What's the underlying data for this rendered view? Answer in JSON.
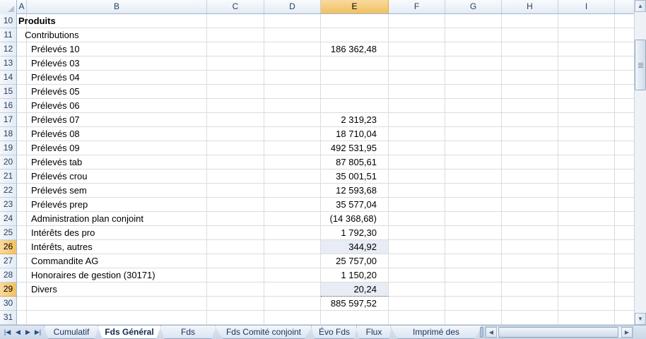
{
  "columns": [
    "A",
    "B",
    "C",
    "D",
    "E",
    "F",
    "G",
    "H",
    "I"
  ],
  "active_column": "E",
  "rows": [
    {
      "num": "10",
      "label": "Produits",
      "value": "",
      "style": "bold",
      "indent": 0
    },
    {
      "num": "11",
      "label": "Contributions",
      "value": "",
      "style": "",
      "indent": 1
    },
    {
      "num": "12",
      "label": "Prélevés 10",
      "value": "186 362,48",
      "style": "",
      "indent": 2
    },
    {
      "num": "13",
      "label": "Prélevés 03",
      "value": "",
      "style": "",
      "indent": 2
    },
    {
      "num": "14",
      "label": "Prélevés 04",
      "value": "",
      "style": "",
      "indent": 2
    },
    {
      "num": "15",
      "label": "Prélevés 05",
      "value": "",
      "style": "",
      "indent": 2
    },
    {
      "num": "16",
      "label": "Prélevés 06",
      "value": "",
      "style": "",
      "indent": 2
    },
    {
      "num": "17",
      "label": "Prélevés 07",
      "value": "2 319,23",
      "style": "",
      "indent": 2
    },
    {
      "num": "18",
      "label": "Prélevés 08",
      "value": "18 710,04",
      "style": "",
      "indent": 2
    },
    {
      "num": "19",
      "label": "Prélevés 09",
      "value": "492 531,95",
      "style": "",
      "indent": 2
    },
    {
      "num": "20",
      "label": "Prélevés tab",
      "value": "87 805,61",
      "style": "",
      "indent": 2
    },
    {
      "num": "21",
      "label": "Prélevés crou",
      "value": "35 001,51",
      "style": "",
      "indent": 2
    },
    {
      "num": "22",
      "label": "Prélevés sem",
      "value": "12 593,68",
      "style": "",
      "indent": 2
    },
    {
      "num": "23",
      "label": "Prélevés prep",
      "value": "35 577,04",
      "style": "",
      "indent": 2
    },
    {
      "num": "24",
      "label": "Administration plan conjoint",
      "value": "(14 368,68)",
      "style": "",
      "indent": 2
    },
    {
      "num": "25",
      "label": "Intérêts des pro",
      "value": "1 792,30",
      "style": "",
      "indent": 2
    },
    {
      "num": "26",
      "label": "Intérêts, autres",
      "value": "344,92",
      "style": "selected",
      "indent": 2
    },
    {
      "num": "27",
      "label": "Commandite AG",
      "value": "25 757,00",
      "style": "",
      "indent": 2
    },
    {
      "num": "28",
      "label": "Honoraires de gestion (30171)",
      "value": "1 150,20",
      "style": "",
      "indent": 2
    },
    {
      "num": "29",
      "label": "Divers",
      "value": "20,24",
      "style": "selected-dotted",
      "indent": 2
    },
    {
      "num": "30",
      "label": "",
      "value": "885 597,52",
      "style": "",
      "indent": 0
    },
    {
      "num": "31",
      "label": "",
      "value": "",
      "style": "",
      "indent": 0
    }
  ],
  "active_rows": [
    "26",
    "29"
  ],
  "sheet_tabs": [
    {
      "label": "Cumulatif",
      "active": false
    },
    {
      "label": "Fds Général",
      "active": true
    },
    {
      "label": "Fds PPRDF",
      "active": false
    },
    {
      "label": "Fds Comité conjoint",
      "active": false
    },
    {
      "label": "Évo Fds",
      "active": false
    },
    {
      "label": "Flux",
      "active": false
    },
    {
      "label": "Imprimé des régularis",
      "active": false
    }
  ],
  "colors": {
    "header_active": "#f1c15f",
    "grid": "#dadcdd",
    "selection": "#e8ecf5"
  }
}
